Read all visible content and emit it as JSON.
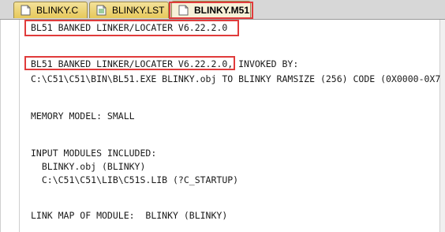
{
  "tabs": [
    {
      "label": "BLINKY.C",
      "icon": "c-file-icon"
    },
    {
      "label": "BLINKY.LST",
      "icon": "lst-file-icon"
    },
    {
      "label": "BLINKY.M51",
      "icon": "m51-file-icon",
      "active": true
    }
  ],
  "lines": [
    "BL51 BANKED LINKER/LOCATER V6.22.2.0",
    "BL51 BANKED LINKER/LOCATER V6.22.2.0, INVOKED BY:",
    "C:\\C51\\C51\\BIN\\BL51.EXE BLINKY.obj TO BLINKY RAMSIZE (256) CODE (0X0000-0X7",
    "MEMORY MODEL: SMALL",
    "INPUT MODULES INCLUDED:",
    "  BLINKY.obj (BLINKY)",
    "  C:\\C51\\C51\\LIB\\C51S.LIB (?C_STARTUP)",
    "LINK MAP OF MODULE:  BLINKY (BLINKY)"
  ],
  "colors": {
    "highlight": "#e03b3b",
    "tab_active": "#f7f1d8",
    "tab_inactive": "#e6c85a"
  }
}
